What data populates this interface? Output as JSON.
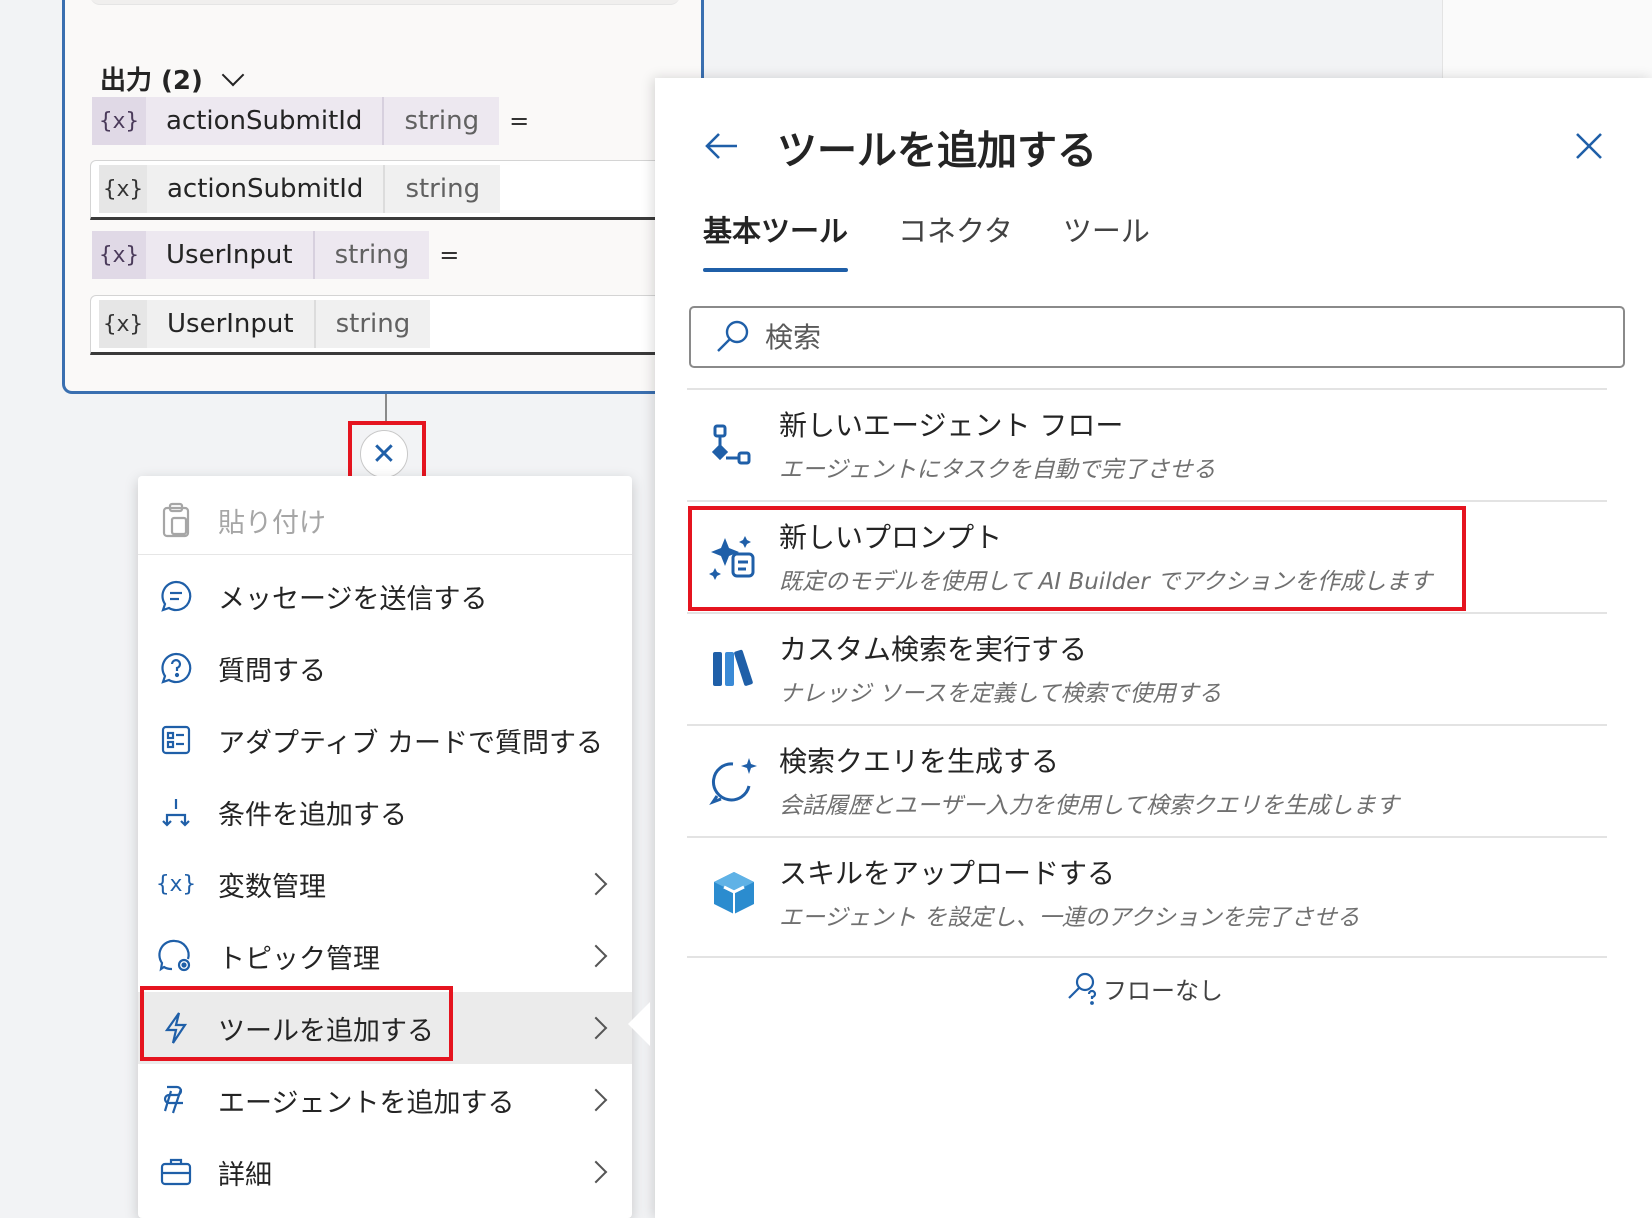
{
  "node": {
    "output_header": "出力 (2)",
    "outputs": [
      {
        "var_icon": "{x}",
        "name": "actionSubmitId",
        "type": "string",
        "eq": "=",
        "field_name": "actionSubmitId",
        "field_type": "string"
      },
      {
        "var_icon": "{x}",
        "name": "UserInput",
        "type": "string",
        "eq": "=",
        "field_name": "UserInput",
        "field_type": "string"
      }
    ]
  },
  "connector": {
    "close_icon": "close-icon",
    "close_glyph": "✕"
  },
  "menu": {
    "items": [
      {
        "label": "貼り付け",
        "icon": "clipboard-icon",
        "disabled": true
      },
      {
        "label": "メッセージを送信する",
        "icon": "chat-icon"
      },
      {
        "label": "質問する",
        "icon": "question-icon"
      },
      {
        "label": "アダプティブ カードで質問する",
        "icon": "card-icon"
      },
      {
        "label": "条件を追加する",
        "icon": "branch-icon"
      },
      {
        "label": "変数管理",
        "icon": "variable-icon",
        "glyph": "{x}"
      },
      {
        "label": "トピック管理",
        "icon": "topic-settings-icon"
      },
      {
        "label": "ツールを追加する",
        "icon": "lightning-icon",
        "active": true
      },
      {
        "label": "エージェントを追加する",
        "icon": "agent-icon"
      },
      {
        "label": "詳細",
        "icon": "briefcase-icon"
      }
    ]
  },
  "panel": {
    "title": "ツールを追加する",
    "tabs": [
      "基本ツール",
      "コネクタ",
      "ツール"
    ],
    "active_tab": "基本ツール",
    "search_placeholder": "検索",
    "items": [
      {
        "title": "新しいエージェント フロー",
        "subtitle": "エージェントにタスクを自動で完了させる",
        "icon": "flow-icon"
      },
      {
        "title": "新しいプロンプト",
        "subtitle": "既定のモデルを使用して AI Builder でアクションを作成します",
        "icon": "prompt-sparkle-icon"
      },
      {
        "title": "カスタム検索を実行する",
        "subtitle": "ナレッジ ソースを定義して検索で使用する",
        "icon": "library-icon"
      },
      {
        "title": "検索クエリを生成する",
        "subtitle": "会話履歴とユーザー入力を使用して検索クエリを生成します",
        "icon": "chat-sparkle-icon"
      },
      {
        "title": "スキルをアップロードする",
        "subtitle": "エージェント を設定し、一連のアクションを完了させる",
        "icon": "cube-icon"
      }
    ],
    "no_flow": "フローなし"
  },
  "colors": {
    "accent": "#1f5fa8",
    "highlight": "#e5141f",
    "node_border": "#3a6fb0"
  }
}
